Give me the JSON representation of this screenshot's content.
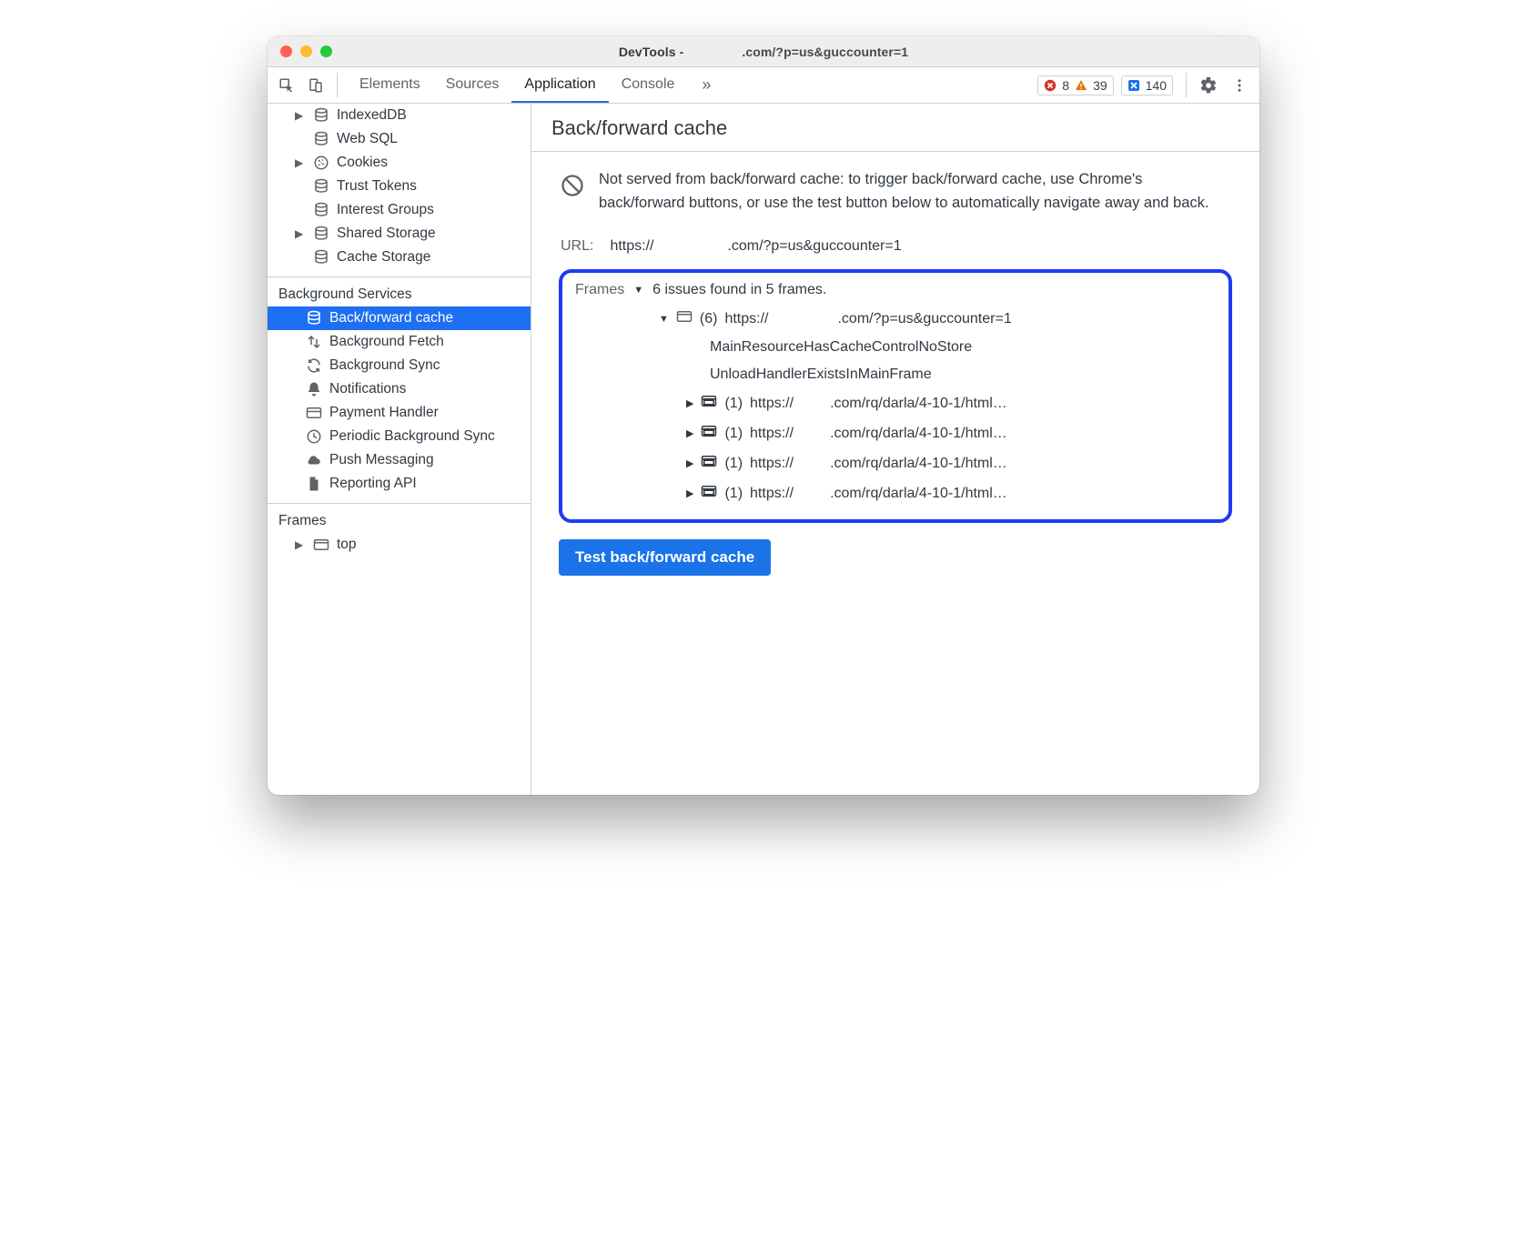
{
  "window": {
    "app": "DevTools - ",
    "title_tail": ".com/?p=us&guccounter=1"
  },
  "colors": {
    "traffic_red": "#ff5f57",
    "traffic_yellow": "#febc2e",
    "traffic_green": "#28c840",
    "error": "#d93025",
    "warn": "#e37400",
    "issue_bg": "#1a73e8",
    "highlight": "#1f3af5"
  },
  "tabs": {
    "items": [
      "Elements",
      "Sources",
      "Application",
      "Console"
    ],
    "active": "Application",
    "more_glyph": "»"
  },
  "badges": {
    "errors": 8,
    "warnings": 39,
    "issues": 140
  },
  "sidebar": {
    "storage": [
      {
        "label": "IndexedDB",
        "icon": "database",
        "expandable": true
      },
      {
        "label": "Web SQL",
        "icon": "database",
        "expandable": false
      },
      {
        "label": "Cookies",
        "icon": "cookie",
        "expandable": true
      },
      {
        "label": "Trust Tokens",
        "icon": "database",
        "expandable": false
      },
      {
        "label": "Interest Groups",
        "icon": "database",
        "expandable": false
      },
      {
        "label": "Shared Storage",
        "icon": "database",
        "expandable": true
      },
      {
        "label": "Cache Storage",
        "icon": "database",
        "expandable": false
      }
    ],
    "bg_services_title": "Background Services",
    "bg_services": [
      {
        "label": "Back/forward cache",
        "icon": "database",
        "selected": true
      },
      {
        "label": "Background Fetch",
        "icon": "transfer",
        "selected": false
      },
      {
        "label": "Background Sync",
        "icon": "sync",
        "selected": false
      },
      {
        "label": "Notifications",
        "icon": "bell",
        "selected": false
      },
      {
        "label": "Payment Handler",
        "icon": "card",
        "selected": false
      },
      {
        "label": "Periodic Background Sync",
        "icon": "clock",
        "selected": false
      },
      {
        "label": "Push Messaging",
        "icon": "cloud",
        "selected": false
      },
      {
        "label": "Reporting API",
        "icon": "file",
        "selected": false
      }
    ],
    "frames_title": "Frames",
    "frames": [
      {
        "label": "top",
        "icon": "frame",
        "expandable": true
      }
    ]
  },
  "panel": {
    "header": "Back/forward cache",
    "not_cached_text": "Not served from back/forward cache: to trigger back/forward cache, use Chrome's back/forward buttons, or use the test button below to automatically navigate away and back.",
    "url_label": "URL:",
    "url_prefix": "https://",
    "url_tail": ".com/?p=us&guccounter=1",
    "frames_label": "Frames",
    "frames_summary": "6 issues found in 5 frames.",
    "main_frame": {
      "count": 6,
      "url_prefix": "https://",
      "url_tail": ".com/?p=us&guccounter=1",
      "reasons": [
        "MainResourceHasCacheControlNoStore",
        "UnloadHandlerExistsInMainFrame"
      ],
      "subframes": [
        {
          "count": 1,
          "url_prefix": "https://",
          "url_tail": ".com/rq/darla/4-10-1/html…"
        },
        {
          "count": 1,
          "url_prefix": "https://",
          "url_tail": ".com/rq/darla/4-10-1/html…"
        },
        {
          "count": 1,
          "url_prefix": "https://",
          "url_tail": ".com/rq/darla/4-10-1/html…"
        },
        {
          "count": 1,
          "url_prefix": "https://",
          "url_tail": ".com/rq/darla/4-10-1/html…"
        }
      ]
    },
    "test_button": "Test back/forward cache"
  }
}
